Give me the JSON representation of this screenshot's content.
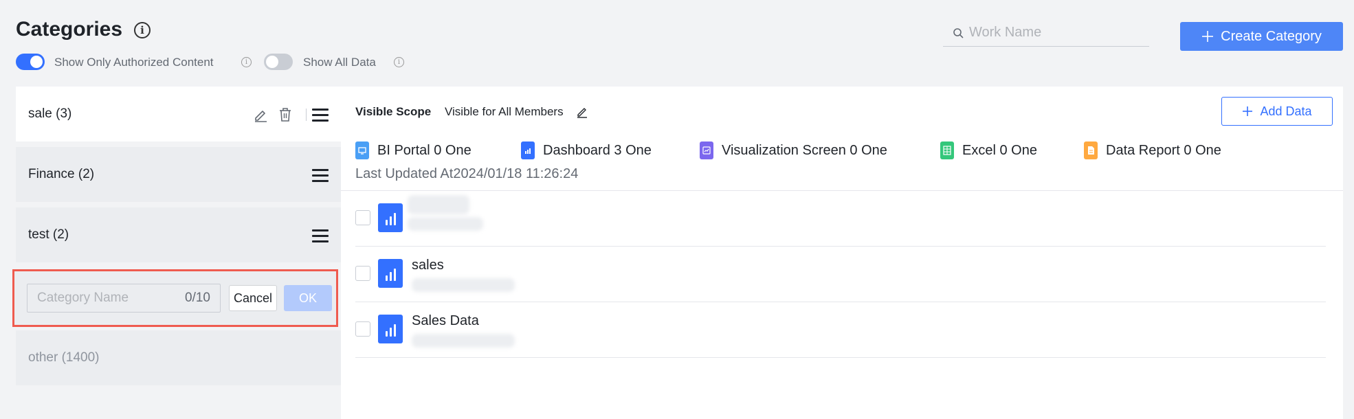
{
  "header": {
    "title": "Categories",
    "info_icon_glyph": "i"
  },
  "toggles": [
    {
      "label": "Show Only Authorized Content",
      "on": true
    },
    {
      "label": "Show All Data",
      "on": false
    }
  ],
  "search": {
    "placeholder": "Work Name",
    "value": ""
  },
  "create_button": {
    "label": "Create Category",
    "icon": "plus-icon"
  },
  "sidebar": {
    "items": [
      {
        "label": "sale (3)",
        "active": true
      },
      {
        "label": "Finance (2)"
      },
      {
        "label": "test (2)"
      },
      {
        "label": "other (1400)"
      }
    ],
    "new_category": {
      "placeholder": "Category Name",
      "count": "0/10",
      "cancel_label": "Cancel",
      "ok_label": "OK"
    }
  },
  "main": {
    "scope_label": "Visible Scope",
    "scope_value": "Visible for All Members",
    "add_data_label": "Add Data",
    "stats": [
      {
        "label": "BI Portal 0 One",
        "icon": "bi-portal-icon",
        "color": "#4a9ff5"
      },
      {
        "label": "Dashboard 3 One",
        "icon": "dashboard-icon",
        "color": "#3370ff"
      },
      {
        "label": "Visualization Screen 0 One",
        "icon": "visualization-screen-icon",
        "color": "#7b67ee"
      },
      {
        "label": "Excel 0 One",
        "icon": "excel-icon",
        "color": "#34c77b"
      },
      {
        "label": "Data Report 0 One",
        "icon": "data-report-icon",
        "color": "#ffa940"
      }
    ],
    "last_updated": "Last Updated At2024/01/18 11:26:24",
    "rows": [
      {
        "name": ""
      },
      {
        "name": "sales"
      },
      {
        "name": "Sales Data"
      }
    ]
  },
  "colors": {
    "accent": "#3370ff",
    "highlight_border": "#ef5b4f"
  }
}
